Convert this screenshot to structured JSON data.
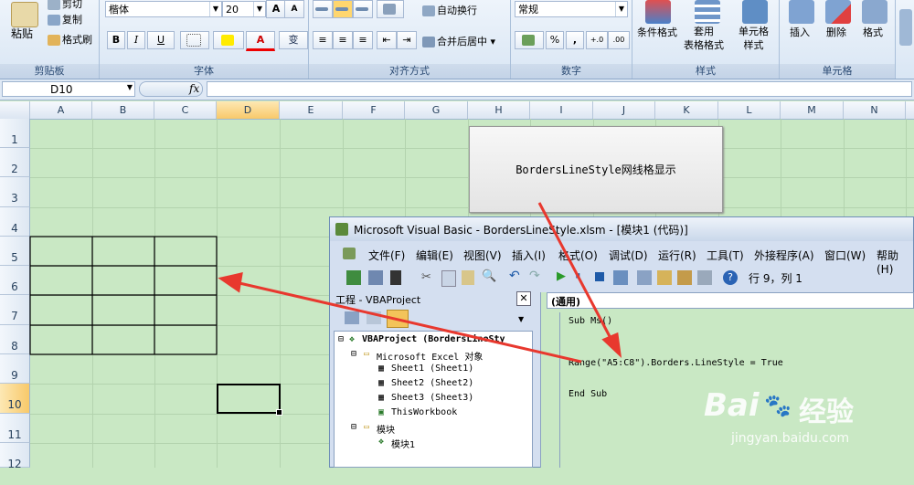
{
  "ribbon": {
    "clipboard": {
      "paste": "粘贴",
      "cut": "剪切",
      "copy": "复制",
      "format_painter": "格式刷",
      "label": "剪贴板"
    },
    "font": {
      "name": "楷体",
      "size": "20",
      "label": "字体",
      "bold": "B",
      "italic": "I",
      "underline": "U",
      "grow": "A",
      "shrink": "A",
      "phonetic": "变"
    },
    "alignment": {
      "wrap": "自动换行",
      "merge": "合并后居中",
      "label": "对齐方式"
    },
    "number": {
      "format": "常规",
      "percent": "%",
      "comma": ",",
      "inc": "+.0",
      "dec": ".00",
      "label": "数字"
    },
    "styles": {
      "conditional": "条件格式",
      "table_format": "套用\n表格格式",
      "cell_styles": "单元格\n样式",
      "label": "样式"
    },
    "cells": {
      "insert": "插入",
      "delete": "删除",
      "format": "格式",
      "label": "单元格"
    }
  },
  "formula_bar": {
    "name_box": "D10",
    "fx": "fx",
    "value": ""
  },
  "sheet": {
    "columns": [
      "A",
      "B",
      "C",
      "D",
      "E",
      "F",
      "G",
      "H",
      "I",
      "J",
      "K",
      "L",
      "M",
      "N"
    ],
    "rows": [
      "1",
      "2",
      "3",
      "4",
      "5",
      "6",
      "7",
      "8",
      "9",
      "10",
      "11",
      "12"
    ],
    "button_label": "BordersLineStyle网线格显示"
  },
  "vba": {
    "title": "Microsoft Visual Basic - BordersLineStyle.xlsm - [模块1 (代码)]",
    "menu": [
      "文件(F)",
      "编辑(E)",
      "视图(V)",
      "插入(I)",
      "格式(O)",
      "调试(D)",
      "运行(R)",
      "工具(T)",
      "外接程序(A)",
      "窗口(W)",
      "帮助(H)"
    ],
    "status": "行 9，列 1",
    "project_title": "工程 - VBAProject",
    "tree": {
      "root": "VBAProject (BordersLineSty",
      "excel_objects": "Microsoft Excel 对象",
      "sheet1": "Sheet1 (Sheet1)",
      "sheet2": "Sheet2 (Sheet2)",
      "sheet3": "Sheet3 (Sheet3)",
      "workbook": "ThisWorkbook",
      "modules": "模块",
      "module1": "模块1"
    },
    "code_combo": "(通用)",
    "code": [
      "Sub Ms()",
      "Range(\"A5:C8\").Borders.LineStyle = True",
      "End Sub"
    ]
  },
  "watermark": {
    "brand": "Bai",
    "brand2": "经验",
    "url": "jingyan.baidu.com"
  }
}
